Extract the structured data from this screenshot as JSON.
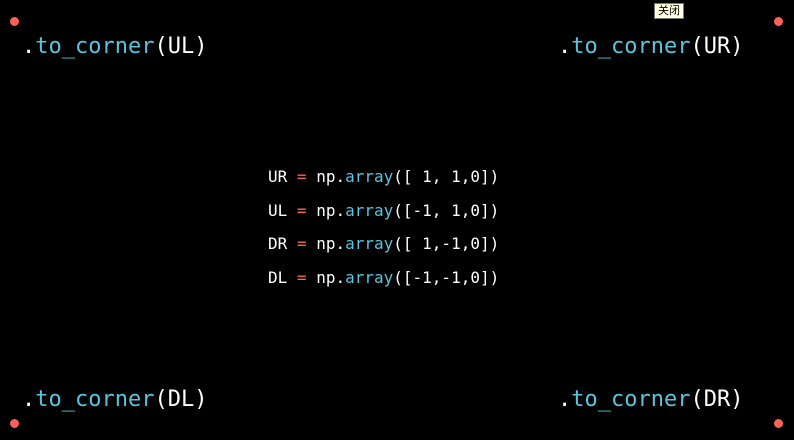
{
  "colors": {
    "background": "#000000",
    "method": "#58c4dd",
    "operator": "#fc6255",
    "corner_dot": "#fc6255",
    "text": "#ffffff"
  },
  "tooltip": {
    "text": "关闭"
  },
  "corners": {
    "ul": {
      "dot": ".",
      "method": "to_corner",
      "arg": "(UL)"
    },
    "ur": {
      "dot": ".",
      "method": "to_corner",
      "arg": "(UR)"
    },
    "dl": {
      "dot": ".",
      "method": "to_corner",
      "arg": "(DL)"
    },
    "dr": {
      "dot": ".",
      "method": "to_corner",
      "arg": "(DR)"
    }
  },
  "code": {
    "lines": [
      {
        "var": "UR",
        "op": "=",
        "mod": "np.",
        "fn": "array",
        "args": "([ 1, 1,0])"
      },
      {
        "var": "UL",
        "op": "=",
        "mod": "np.",
        "fn": "array",
        "args": "([-1, 1,0])"
      },
      {
        "var": "DR",
        "op": "=",
        "mod": "np.",
        "fn": "array",
        "args": "([ 1,-1,0])"
      },
      {
        "var": "DL",
        "op": "=",
        "mod": "np.",
        "fn": "array",
        "args": "([-1,-1,0])"
      }
    ]
  }
}
